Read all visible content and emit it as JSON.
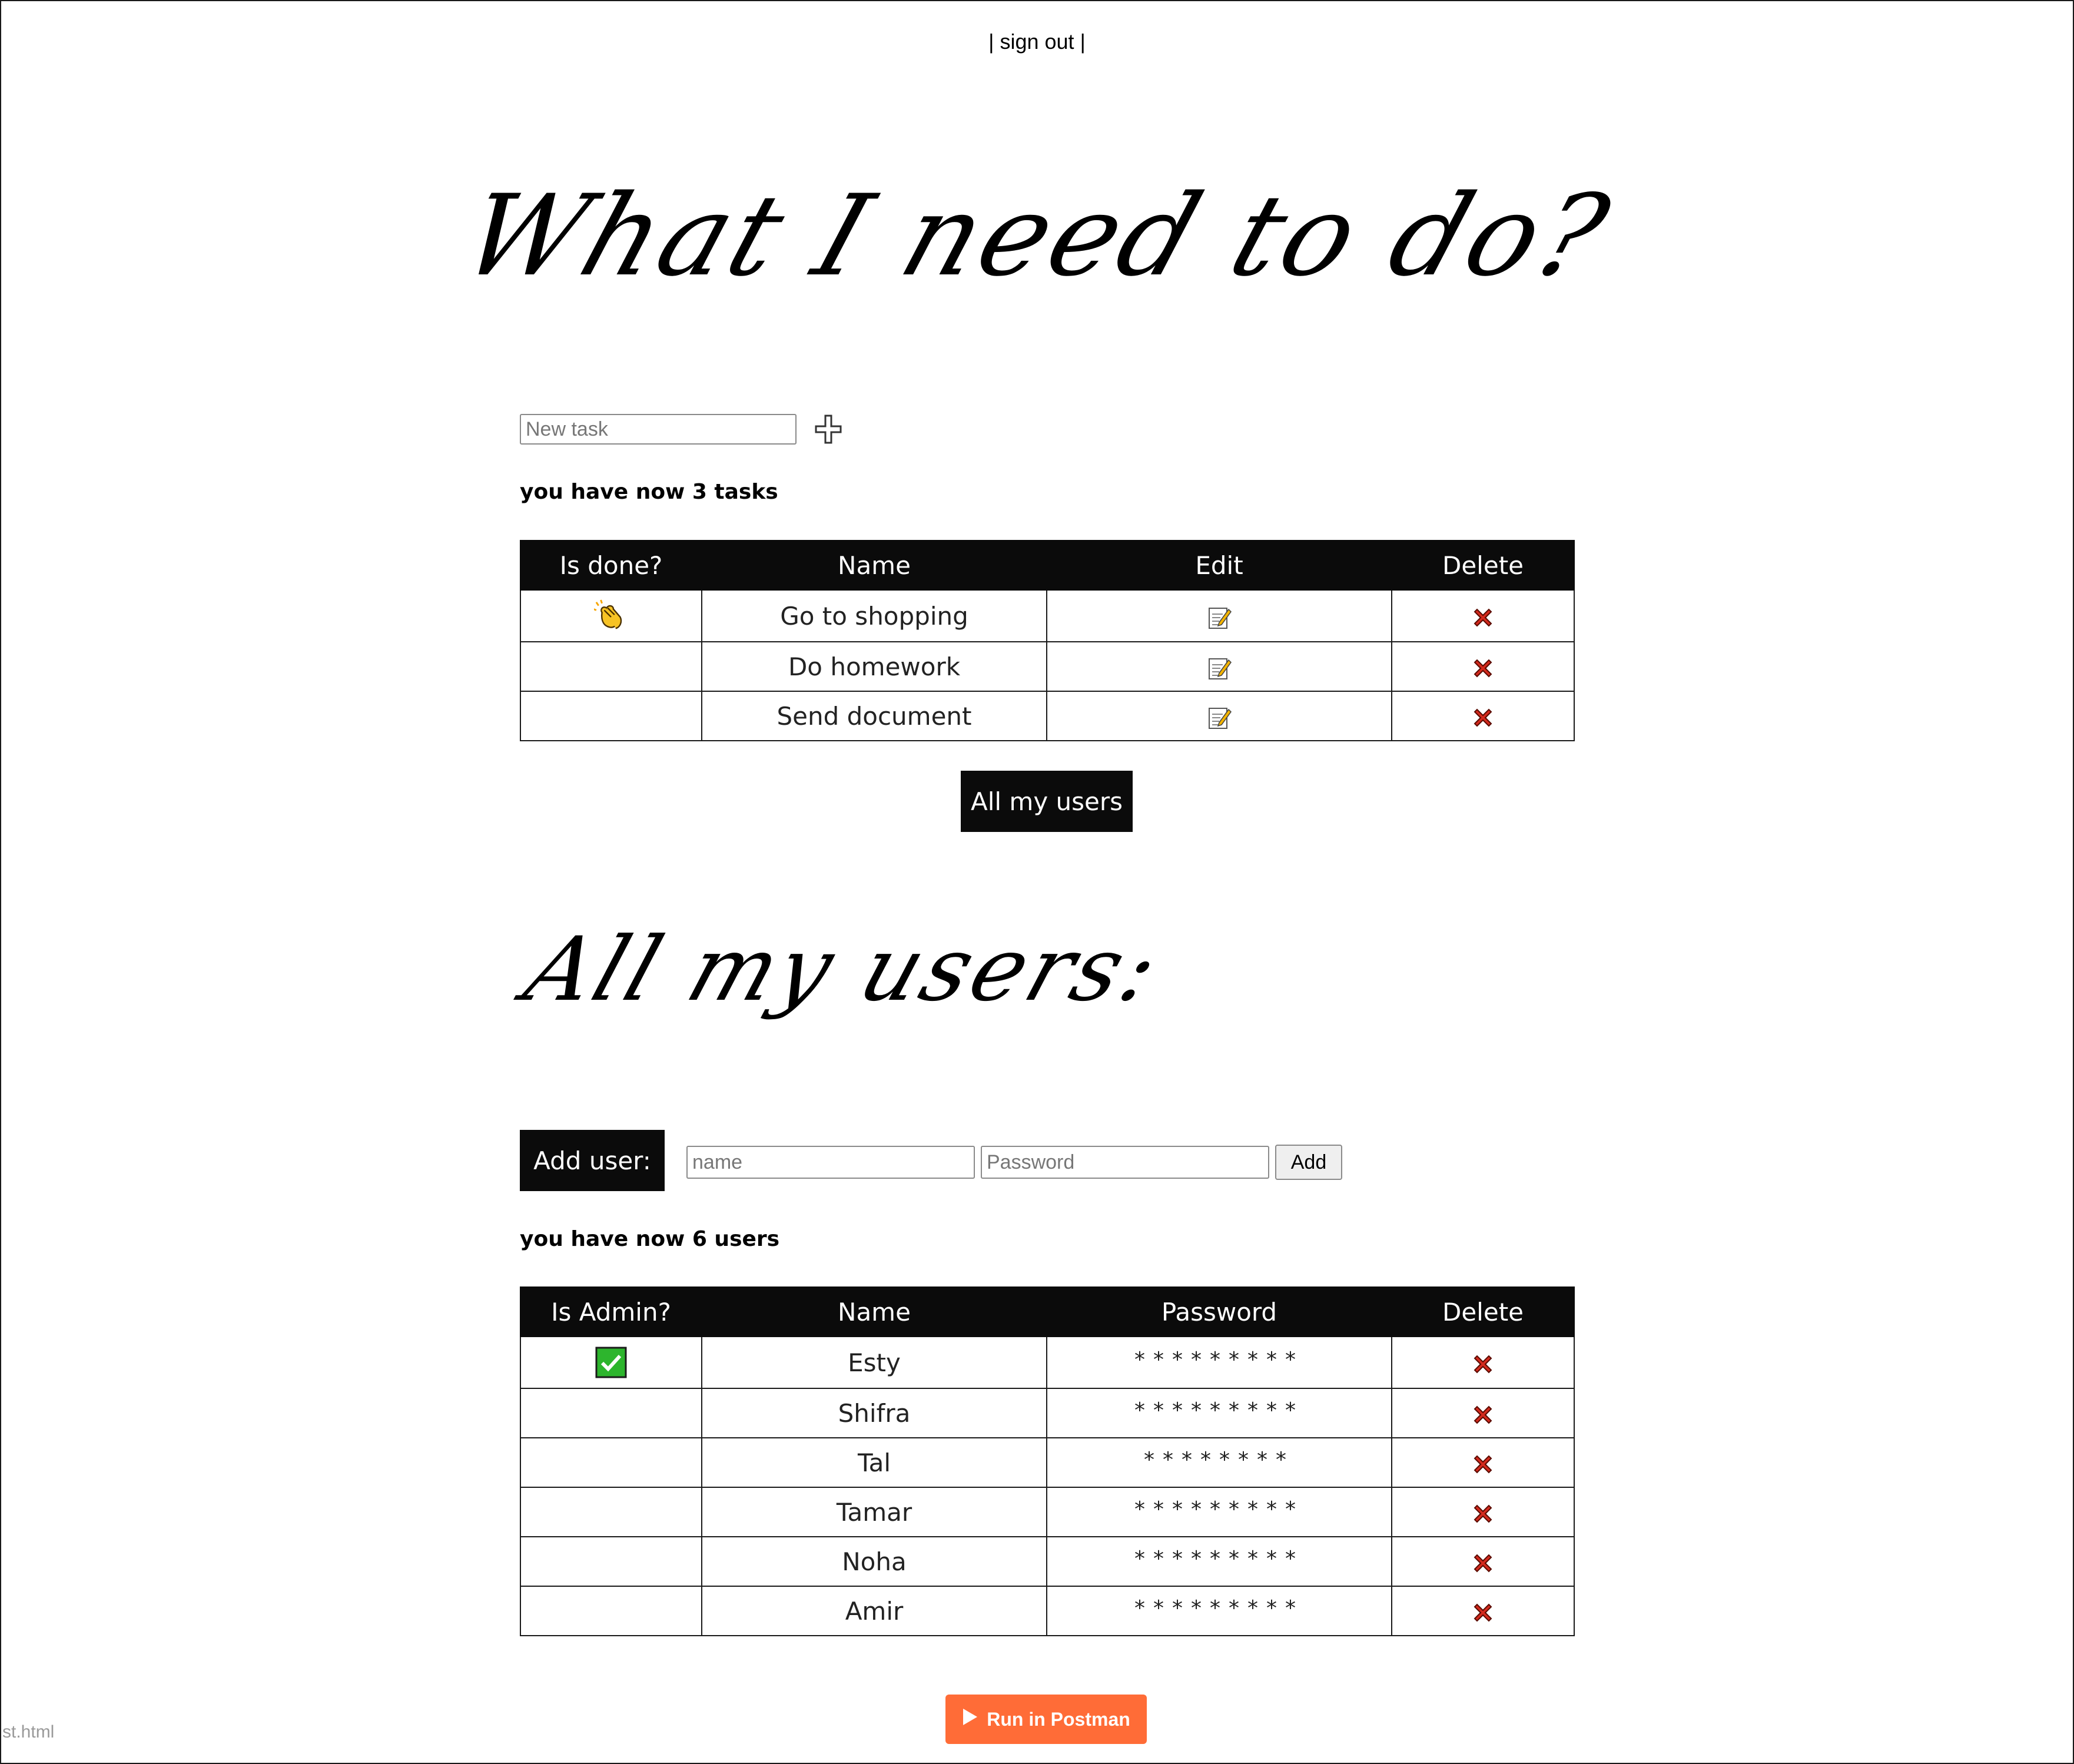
{
  "header": {
    "sign_out": "| sign out |"
  },
  "tasks_section": {
    "title": "What I need to do?",
    "new_task_placeholder": "New task",
    "count_text": "you have now 3 tasks",
    "columns": [
      "Is done?",
      "Name",
      "Edit",
      "Delete"
    ],
    "rows": [
      {
        "name": "Go to shopping",
        "done": true
      },
      {
        "name": "Do homework",
        "done": false
      },
      {
        "name": "Send document",
        "done": false
      }
    ],
    "all_users_button": "All my users"
  },
  "users_section": {
    "title": "All my users:",
    "add_user_label": "Add user:",
    "name_placeholder": "name",
    "password_placeholder": "Password",
    "add_button": "Add",
    "count_text": "you have now 6 users",
    "columns": [
      "Is Admin?",
      "Name",
      "Password",
      "Delete"
    ],
    "rows": [
      {
        "name": "Esty",
        "password": "*********",
        "admin": true
      },
      {
        "name": "Shifra",
        "password": "*********",
        "admin": false
      },
      {
        "name": "Tal",
        "password": "********",
        "admin": false
      },
      {
        "name": "Tamar",
        "password": "*********",
        "admin": false
      },
      {
        "name": "Noha",
        "password": "*********",
        "admin": false
      },
      {
        "name": "Amir",
        "password": "*********",
        "admin": false
      }
    ]
  },
  "footer": {
    "postman_button": "Run in Postman",
    "postman_color": "#ff6c37",
    "stray_text": "st.html"
  },
  "icons": {
    "add_task": "plus-icon",
    "done": "clapping-hands-icon",
    "admin": "check-mark-icon",
    "edit": "memo-icon",
    "delete": "cross-mark-icon",
    "postman": "play-icon"
  }
}
